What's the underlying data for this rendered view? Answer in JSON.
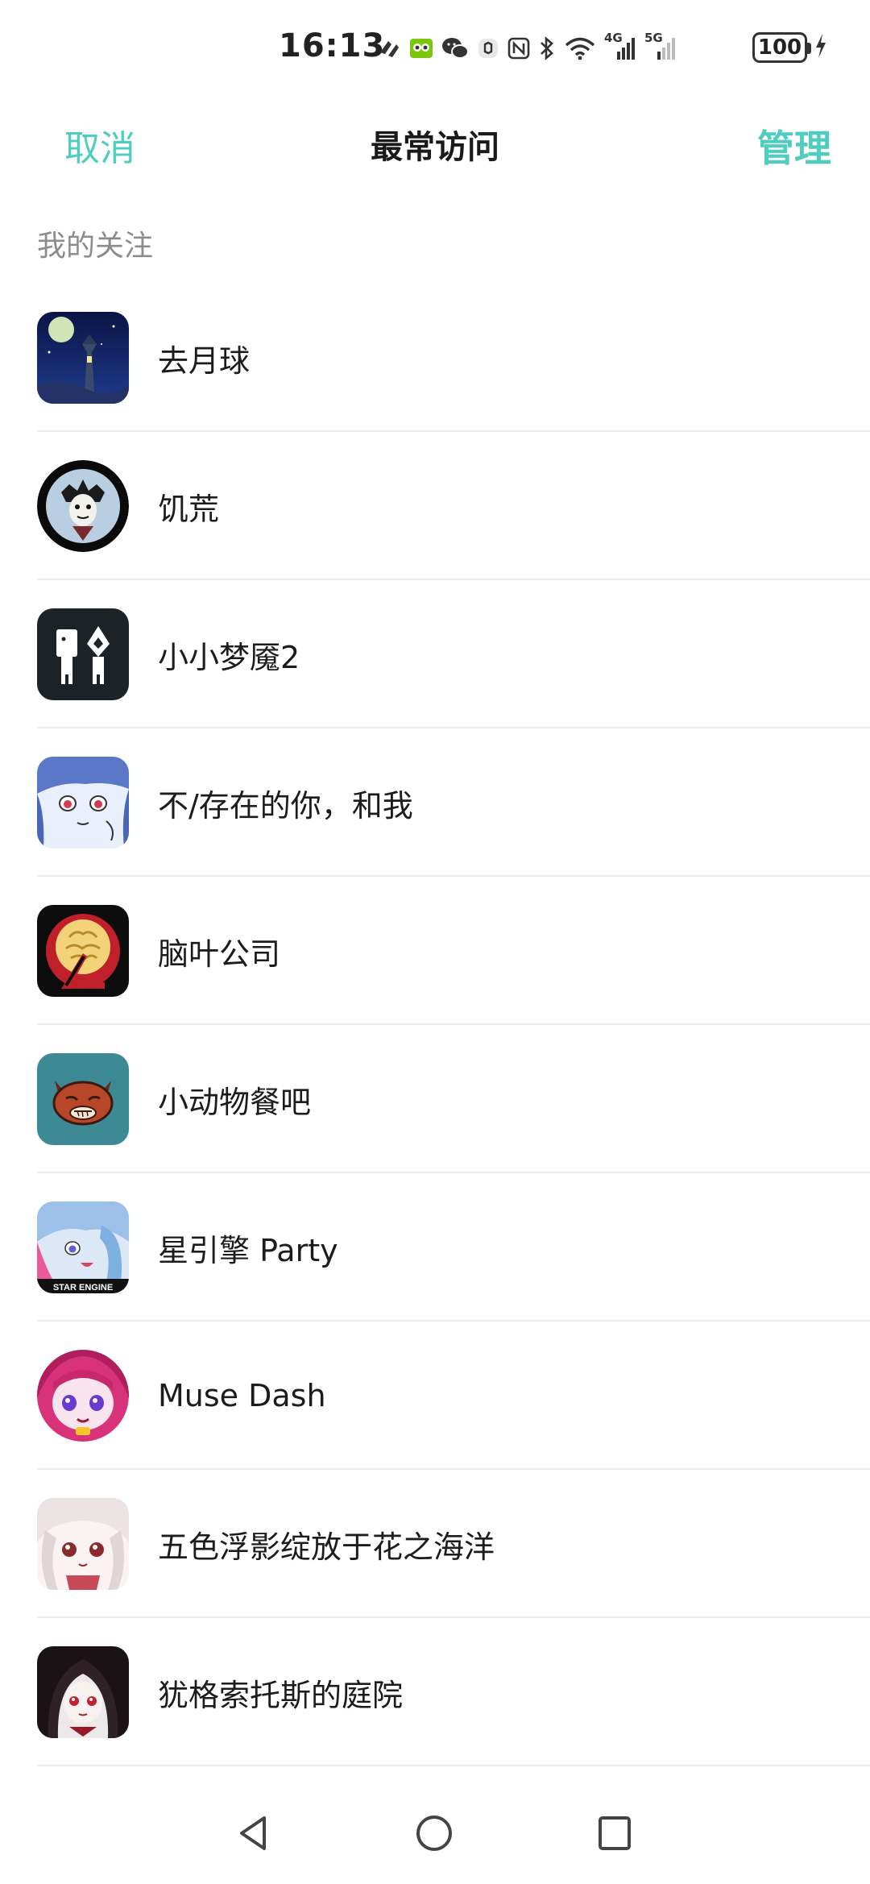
{
  "status_bar": {
    "time": "16:13",
    "battery": "100",
    "signal_4g": "4G",
    "signal_5g": "5G"
  },
  "header": {
    "cancel_label": "取消",
    "title": "最常访问",
    "manage_label": "管理"
  },
  "section": {
    "label": "我的关注"
  },
  "items": [
    {
      "label": "去月球",
      "icon": "to-the-moon-game-icon"
    },
    {
      "label": "饥荒",
      "icon": "dont-starve-game-icon"
    },
    {
      "label": "小小梦魇2",
      "icon": "little-nightmares-2-game-icon"
    },
    {
      "label": "不/存在的你，和我",
      "icon": "the-you-i-exist-game-icon"
    },
    {
      "label": "脑叶公司",
      "icon": "lobotomy-corp-game-icon"
    },
    {
      "label": "小动物餐吧",
      "icon": "animal-restaurant-game-icon"
    },
    {
      "label": "星引擎 Party",
      "icon": "star-engine-party-game-icon"
    },
    {
      "label": "Muse Dash",
      "icon": "muse-dash-game-icon"
    },
    {
      "label": "五色浮影绽放于花之海洋",
      "icon": "five-colors-flower-sea-game-icon"
    },
    {
      "label": "犹格索托斯的庭院",
      "icon": "yog-sothoth-garden-game-icon"
    }
  ],
  "icons_text": {
    "star_engine": "STAR ENGINE"
  },
  "colors": {
    "accent": "#4fcdbf",
    "divider": "#ececec",
    "section_label": "#8c8c8c"
  }
}
